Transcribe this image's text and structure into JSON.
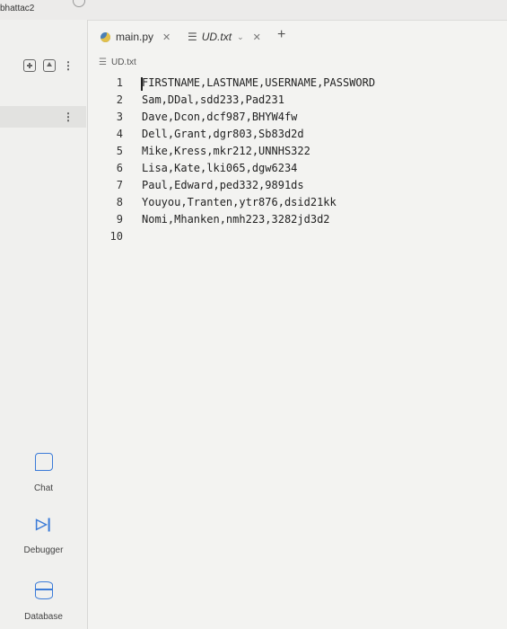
{
  "topbar": {
    "user": "bhattac2"
  },
  "sidebar": {
    "chat_label": "Chat",
    "debugger_label": "Debugger",
    "database_label": "Database"
  },
  "tabs": [
    {
      "label": "main.py",
      "icon": "python-icon"
    },
    {
      "label": "UD.txt",
      "icon": "text-file-icon"
    }
  ],
  "breadcrumb": {
    "file": "UD.txt"
  },
  "editor": {
    "lines": [
      {
        "n": "1",
        "text": "FIRSTNAME,LASTNAME,USERNAME,PASSWORD"
      },
      {
        "n": "2",
        "text": "Sam,DDal,sdd233,Pad231"
      },
      {
        "n": "3",
        "text": "Dave,Dcon,dcf987,BHYW4fw"
      },
      {
        "n": "4",
        "text": "Dell,Grant,dgr803,Sb83d2d"
      },
      {
        "n": "5",
        "text": "Mike,Kress,mkr212,UNNHS322"
      },
      {
        "n": "6",
        "text": "Lisa,Kate,lki065,dgw6234"
      },
      {
        "n": "7",
        "text": "Paul,Edward,ped332,9891ds"
      },
      {
        "n": "8",
        "text": "Youyou,Tranten,ytr876,dsid21kk"
      },
      {
        "n": "9",
        "text": "Nomi,Mhanken,nmh223,3282jd3d2"
      },
      {
        "n": "10",
        "text": ""
      }
    ]
  }
}
